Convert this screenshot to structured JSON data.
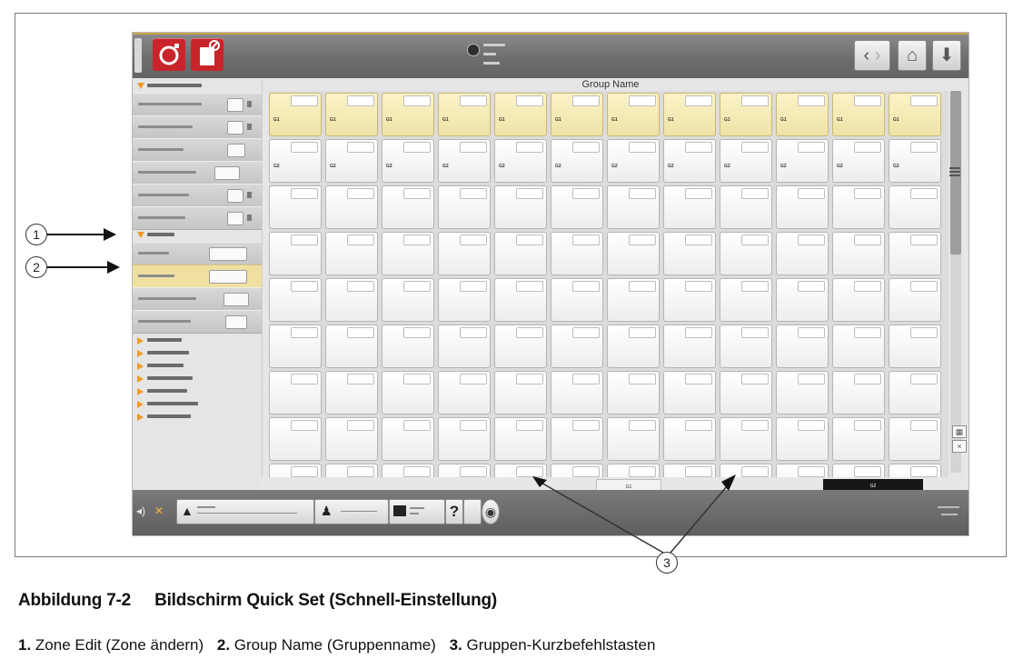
{
  "screen": {
    "grid_title": "Group Name",
    "group_shortcuts": [
      "G1",
      "G2"
    ]
  },
  "callouts": [
    "1",
    "2",
    "3"
  ],
  "caption": {
    "figure_number": "Abbildung 7-2",
    "figure_title": "Bildschirm Quick Set (Schnell-Einstellung)"
  },
  "legend": [
    {
      "num": "1.",
      "text": "Zone Edit (Zone ändern)"
    },
    {
      "num": "2.",
      "text": "Group Name (Gruppenname)"
    },
    {
      "num": "3.",
      "text": "Gruppen-Kurzbefehlstasten"
    }
  ],
  "colors": {
    "accent_orange": "#f19a24",
    "brand_red": "#c8252b",
    "highlight_yellow": "#efe0a2"
  }
}
